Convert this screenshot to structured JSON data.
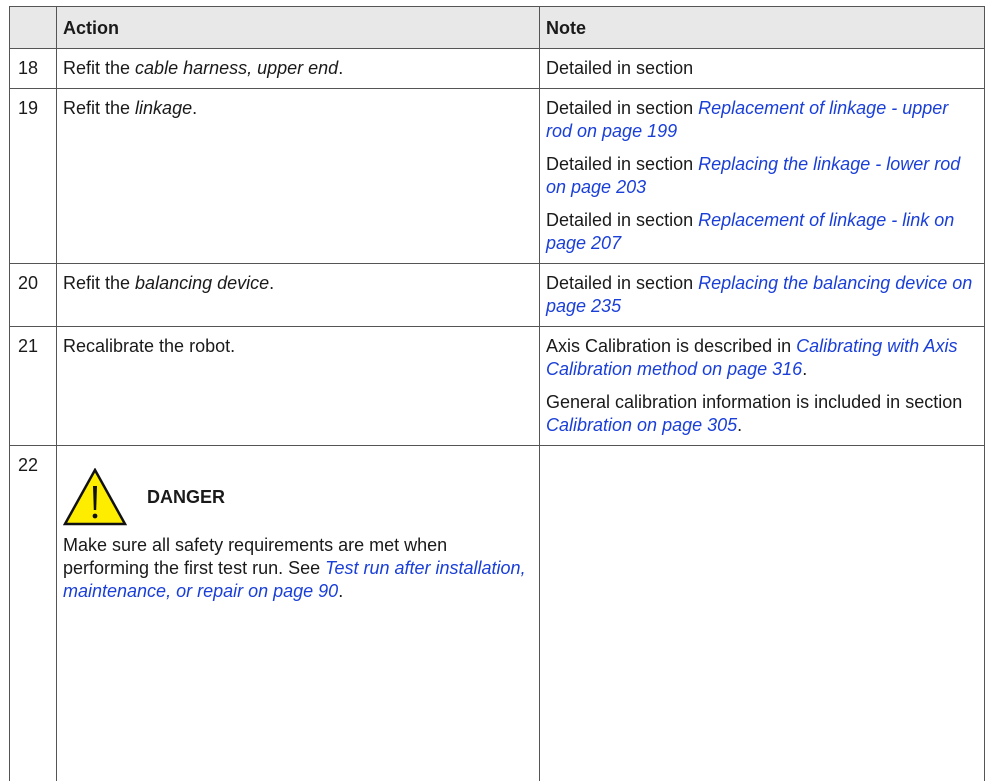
{
  "table": {
    "headers": {
      "step": "",
      "action": "Action",
      "note": "Note"
    },
    "rows": [
      {
        "step": "18",
        "action": {
          "pre": "Refit the ",
          "em": "cable harness, upper end",
          "post": "."
        },
        "notes": [
          {
            "text": "Detailed in section",
            "link": ""
          }
        ]
      },
      {
        "step": "19",
        "action": {
          "pre": "Refit the ",
          "em": "linkage",
          "post": "."
        },
        "notes": [
          {
            "text": "Detailed in section ",
            "link": "Replacement of linkage - upper rod on page 199"
          },
          {
            "text": "Detailed in section ",
            "link": "Replacing the linkage - lower rod on page 203"
          },
          {
            "text": "Detailed in section ",
            "link": "Replacement of linkage - link on page 207"
          }
        ]
      },
      {
        "step": "20",
        "action": {
          "pre": "Refit the ",
          "em": "balancing device",
          "post": "."
        },
        "notes": [
          {
            "text": "Detailed in section ",
            "link": "Replacing the balancing device on page 235"
          }
        ]
      },
      {
        "step": "21",
        "action": {
          "pre": "Recalibrate the robot.",
          "em": "",
          "post": ""
        },
        "notes": [
          {
            "text": "Axis Calibration is described in ",
            "link": "Calibrating with Axis Calibration method on page 316",
            "post": "."
          },
          {
            "text": "General calibration information is included in section ",
            "link": "Calibration on page 305",
            "post": "."
          }
        ]
      },
      {
        "step": "22",
        "danger": {
          "title": "DANGER",
          "icon": "warning-triangle-icon",
          "text": "Make sure all safety requirements are met when performing the first test run. See ",
          "link": "Test run after installation, maintenance, or repair on page 90",
          "post": "."
        }
      }
    ]
  },
  "colors": {
    "link": "#1a3fd8",
    "header_bg": "#e8e8e8",
    "warning_yellow": "#ffed00"
  }
}
